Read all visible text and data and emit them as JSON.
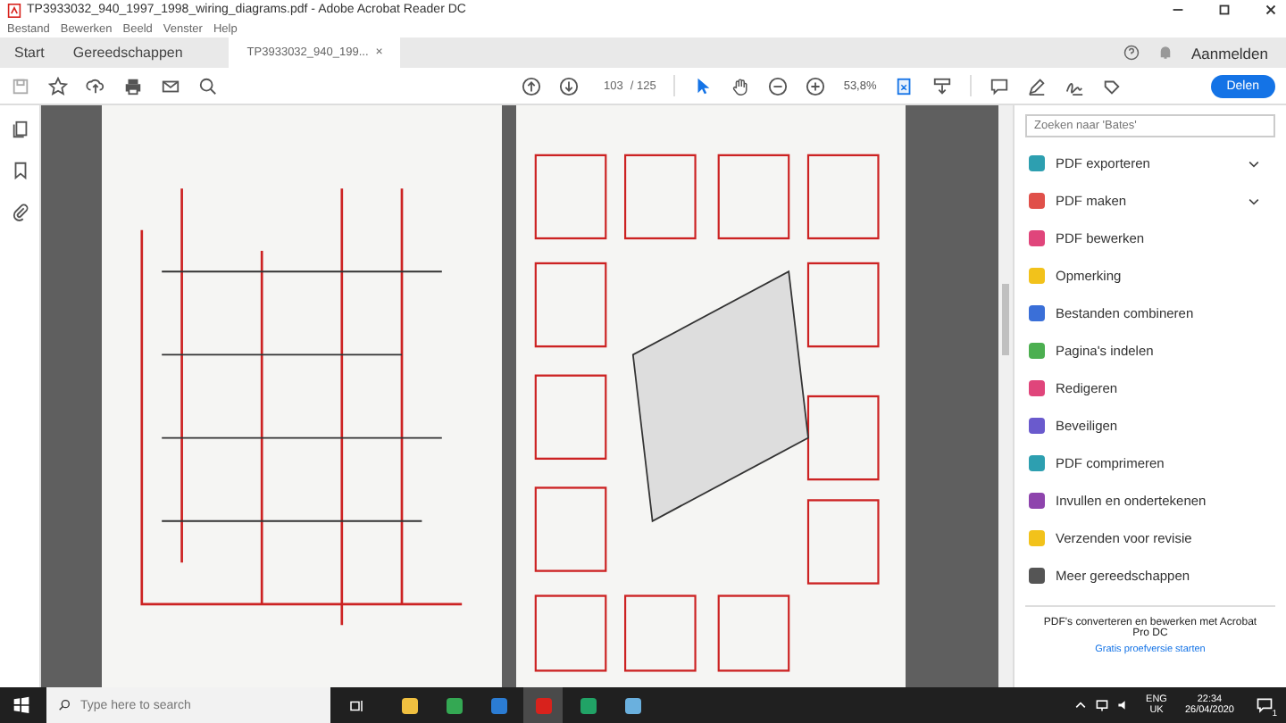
{
  "window": {
    "title": "TP3933032_940_1997_1998_wiring_diagrams.pdf - Adobe Acrobat Reader DC"
  },
  "menu": [
    "Bestand",
    "Bewerken",
    "Beeld",
    "Venster",
    "Help"
  ],
  "tabs": [
    {
      "label": "Start",
      "selected": false
    },
    {
      "label": "Gereedschappen",
      "selected": false
    },
    {
      "label": "TP3933032_940_199...",
      "selected": true,
      "close": "×"
    }
  ],
  "sign_in": "Aanmelden",
  "toolbar": {
    "page": "103",
    "page_total": "/ 125",
    "zoom": "53,8%",
    "share": "Delen"
  },
  "search": {
    "placeholder": "Zoeken naar 'Bates'"
  },
  "tools": [
    {
      "label": "PDF exporteren",
      "color": "#2d9fb0",
      "expandable": true
    },
    {
      "label": "PDF maken",
      "color": "#e0504a",
      "expandable": true
    },
    {
      "label": "PDF bewerken",
      "color": "#e0457b",
      "expandable": false
    },
    {
      "label": "Opmerking",
      "color": "#f2c21b",
      "expandable": false
    },
    {
      "label": "Bestanden combineren",
      "color": "#3a6fd8",
      "expandable": false
    },
    {
      "label": "Pagina's indelen",
      "color": "#4caf50",
      "expandable": false
    },
    {
      "label": "Redigeren",
      "color": "#e0457b",
      "expandable": false
    },
    {
      "label": "Beveiligen",
      "color": "#6a5acd",
      "expandable": false
    },
    {
      "label": "PDF comprimeren",
      "color": "#2d9fb0",
      "expandable": false
    },
    {
      "label": "Invullen en ondertekenen",
      "color": "#8e44ad",
      "expandable": false
    },
    {
      "label": "Verzenden voor revisie",
      "color": "#f2c21b",
      "expandable": false
    },
    {
      "label": "Meer gereedschappen",
      "color": "#555555",
      "expandable": false
    }
  ],
  "promo": {
    "text": "PDF's converteren en bewerken met Acrobat Pro DC",
    "link": "Gratis proefversie starten"
  },
  "taskbar": {
    "search_placeholder": "Type here to search",
    "apps": [
      {
        "color": "#f0c040",
        "selected": false
      },
      {
        "color": "#34a853",
        "selected": false
      },
      {
        "color": "#2b7cd3",
        "selected": false
      },
      {
        "color": "#d8221c",
        "selected": true
      },
      {
        "color": "#21a366",
        "selected": false
      },
      {
        "color": "#6ab0de",
        "selected": false
      }
    ],
    "language": "ENG",
    "region": "UK",
    "time": "22:34",
    "date": "26/04/2020",
    "notifications": "1"
  }
}
